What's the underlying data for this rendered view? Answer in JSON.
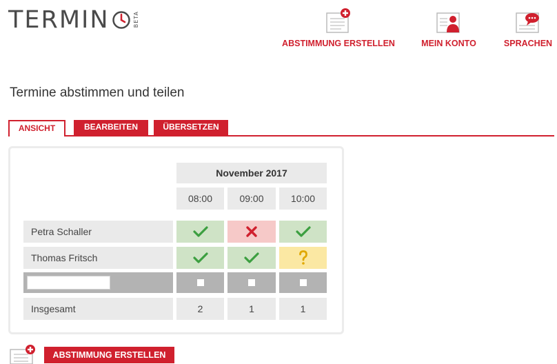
{
  "brand": {
    "name": "TERMIN",
    "badge": "BETA"
  },
  "nav": [
    {
      "label": "ABSTIMMUNG ERSTELLEN",
      "icon": "create-poll-icon"
    },
    {
      "label": "MEIN KONTO",
      "icon": "account-icon"
    },
    {
      "label": "SPRACHEN",
      "icon": "languages-icon"
    }
  ],
  "page": {
    "title": "Termine abstimmen und teilen"
  },
  "tabs": [
    {
      "label": "ANSICHT",
      "active": true
    },
    {
      "label": "BEARBEITEN",
      "active": false
    },
    {
      "label": "ÜBERSETZEN",
      "active": false
    }
  ],
  "poll": {
    "month": "November 2017",
    "times": [
      "08:00",
      "09:00",
      "10:00"
    ],
    "participants": [
      {
        "name": "Petra Schaller",
        "votes": [
          "yes",
          "no",
          "yes"
        ]
      },
      {
        "name": "Thomas Fritsch",
        "votes": [
          "yes",
          "yes",
          "maybe"
        ]
      }
    ],
    "new_row": {
      "name_value": "",
      "checkboxes": [
        false,
        false,
        false
      ]
    },
    "totals": {
      "label": "Insgesamt",
      "values": [
        "2",
        "1",
        "1"
      ]
    }
  },
  "cta": {
    "label": "ABSTIMMUNG ERSTELLEN",
    "icon": "create-poll-icon"
  },
  "colors": {
    "accent": "#d0202e",
    "yes_bg": "#cfe3c6",
    "no_bg": "#f6c9c8",
    "maybe_bg": "#fbe8a3",
    "yes_mark": "#3c9f40",
    "no_mark": "#d0202e",
    "maybe_mark": "#e0a800"
  }
}
